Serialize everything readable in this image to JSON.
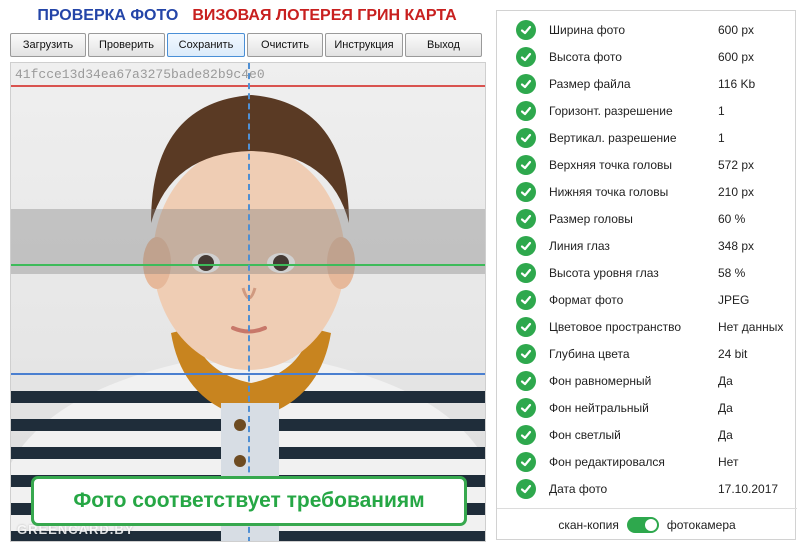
{
  "header": {
    "title_left": "ПРОВЕРКА ФОТО",
    "title_right": "ВИЗОВАЯ ЛОТЕРЕЯ ГРИН КАРТА",
    "title_left_color": "#2445a8",
    "title_right_color": "#c8201f"
  },
  "toolbar": {
    "load": "Загрузить",
    "check": "Проверить",
    "save": "Сохранить",
    "clear": "Очистить",
    "instructions": "Инструкция",
    "exit": "Выход"
  },
  "photo": {
    "hash": "41fcce13d34ea67a3275bade82b9c4e0",
    "watermark": "GREENCARD.BY",
    "status_message": "Фото соответствует требованиям",
    "guide_colors": {
      "top_of_head": "#d9534f",
      "eye_line": "#3dbb5a",
      "chin_line": "#4a7fd0",
      "center_line": "#4f8fd3"
    }
  },
  "checks": [
    {
      "label": "Ширина фото",
      "value": "600 px",
      "ok": true
    },
    {
      "label": "Высота фото",
      "value": "600 px",
      "ok": true
    },
    {
      "label": "Размер файла",
      "value": "116 Kb",
      "ok": true
    },
    {
      "label": "Горизонт. разрешение",
      "value": "1",
      "ok": true
    },
    {
      "label": "Вертикал. разрешение",
      "value": "1",
      "ok": true
    },
    {
      "label": "Верхняя точка головы",
      "value": "572 px",
      "ok": true
    },
    {
      "label": "Нижняя точка головы",
      "value": "210 px",
      "ok": true
    },
    {
      "label": "Размер головы",
      "value": "60 %",
      "ok": true
    },
    {
      "label": "Линия глаз",
      "value": "348 px",
      "ok": true
    },
    {
      "label": "Высота уровня глаз",
      "value": "58 %",
      "ok": true
    },
    {
      "label": "Формат фото",
      "value": "JPEG",
      "ok": true
    },
    {
      "label": "Цветовое пространство",
      "value": "Нет данных",
      "ok": true
    },
    {
      "label": "Глубина цвета",
      "value": "24 bit",
      "ok": true
    },
    {
      "label": "Фон равномерный",
      "value": "Да",
      "ok": true
    },
    {
      "label": "Фон нейтральный",
      "value": "Да",
      "ok": true
    },
    {
      "label": "Фон светлый",
      "value": "Да",
      "ok": true
    },
    {
      "label": "Фон редактировался",
      "value": "Нет",
      "ok": true
    },
    {
      "label": "Дата фото",
      "value": "17.10.2017",
      "ok": true
    }
  ],
  "mode_toggle": {
    "left_label": "скан-копия",
    "right_label": "фотокамера",
    "selected": "фотокамера"
  },
  "colors": {
    "ok_green": "#2ea84d",
    "accent_blue": "#4a8fd6"
  }
}
